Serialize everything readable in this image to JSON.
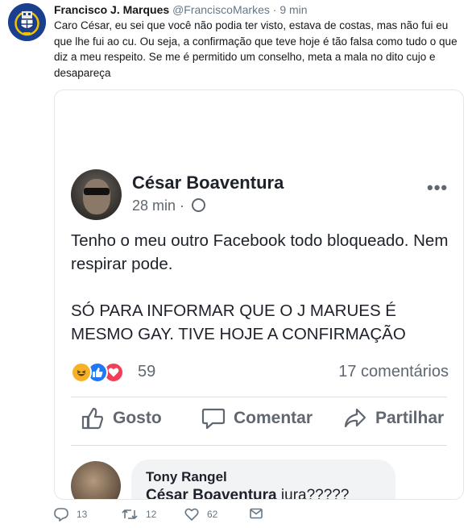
{
  "tweet": {
    "author_name": "Francisco J. Marques",
    "author_handle": "@FranciscoMarkes",
    "separator": "·",
    "time": "9 min",
    "text": "Caro César, eu sei que você não podia ter visto, estava de costas, mas não fui eu que lhe fui ao cu. Ou seja, a confirmação que teve hoje é tão falsa como tudo o que diz a meu respeito. Se me é permitido um conselho, meta a mala no dito cujo e desapareça",
    "replies": "13",
    "retweets": "12",
    "likes": "62"
  },
  "fb_post": {
    "author": "César Boaventura",
    "time": "28 min",
    "separator": "·",
    "more": "•••",
    "paragraph_1": "Tenho o meu outro Facebook todo bloqueado. Nem respirar pode.",
    "paragraph_2": "SÓ PARA INFORMAR QUE O J MARUES É MESMO GAY. TIVE HOJE A CONFIRMAÇÃO",
    "reaction_count": "59",
    "comments_count": "17 comentários",
    "actions": {
      "like": "Gosto",
      "comment": "Comentar",
      "share": "Partilhar"
    },
    "comment": {
      "author": "Tony Rangel",
      "mention": "César Boaventura",
      "text": " jura?????"
    }
  },
  "icons": {
    "avatar": "fc-porto-crest-icon",
    "reply": "reply-icon",
    "retweet": "retweet-icon",
    "like": "heart-icon",
    "dm": "envelope-icon"
  },
  "colors": {
    "tweet_meta": "#657786",
    "fb_like": "#2078f4",
    "fb_love": "#f33e58",
    "fb_haha": "#f7b125"
  }
}
